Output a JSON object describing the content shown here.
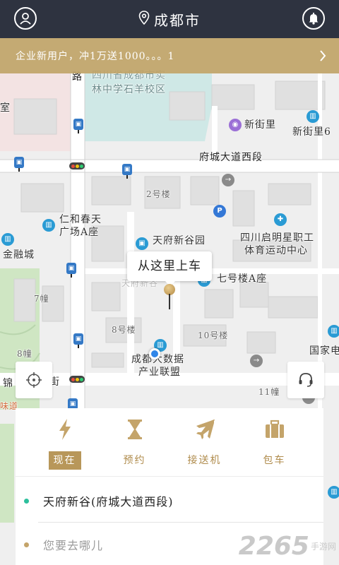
{
  "header": {
    "city": "成都市",
    "profile_icon": "user-icon",
    "bell_icon": "bell-icon",
    "location_icon": "map-pin-icon"
  },
  "promo": {
    "text": "企业新用户，冲1万送1000。。。1",
    "chevron_icon": "chevron-right-icon"
  },
  "map": {
    "labels": {
      "school": "四川省成都市实",
      "school2": "林中学石羊校区",
      "road_vertical": "路",
      "xinjieli": "新街里",
      "xinjieli6": "新街里6",
      "fucheng_road": "府城大道西段",
      "building2": "2号楼",
      "renhe": "仁和春天",
      "renhe2": "广场A座",
      "jinrong": "金融城",
      "tianfu_xingu": "天府新谷园",
      "sichuan_qiming": "四川启明星职工",
      "sichuan_qiming2": "体育运动中心",
      "building7a": "七号楼A座",
      "building7": "7幢",
      "building8": "8号楼",
      "building10": "10号楼",
      "building8zhuang": "8幢",
      "bigdata": "成都大数据",
      "bigdata2": "产业联盟",
      "guojia": "国家电",
      "building11": "11幢",
      "jin": "锦",
      "jie": "街",
      "shi": "室",
      "weidao": "味道",
      "faded": "天府新谷"
    },
    "pickup_text": "从这里上车",
    "locate_icon": "crosshair-icon",
    "service_icon": "headset-icon"
  },
  "panel": {
    "tabs": [
      {
        "label": "现在",
        "icon": "lightning-icon",
        "active": true
      },
      {
        "label": "预约",
        "icon": "hourglass-icon",
        "active": false
      },
      {
        "label": "接送机",
        "icon": "airplane-icon",
        "active": false
      },
      {
        "label": "包车",
        "icon": "briefcase-icon",
        "active": false
      }
    ],
    "from_text": "天府新谷(府城大道西段)",
    "to_placeholder": "您要去哪儿"
  },
  "watermark": {
    "number": "2265",
    "suffix": "手游网"
  },
  "colors": {
    "header_bg": "#2e3340",
    "accent_gold": "#b8975a",
    "from_dot": "#2dbf9c",
    "to_dot": "#c4a46a"
  }
}
